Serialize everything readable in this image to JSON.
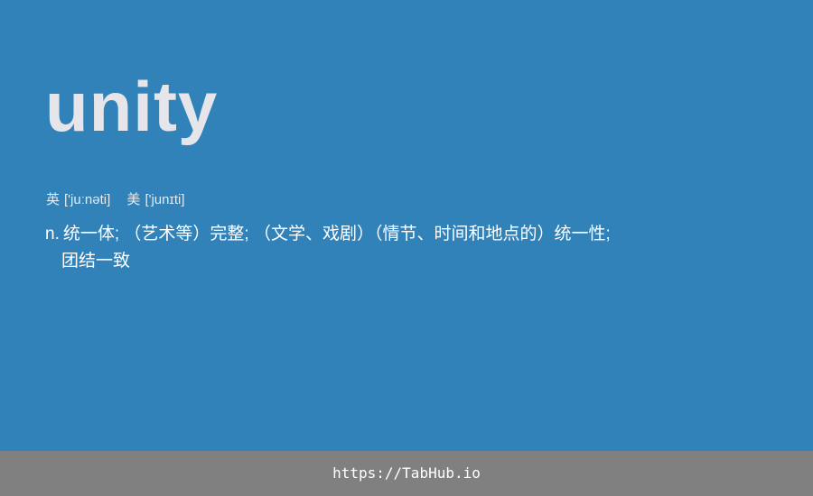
{
  "entry": {
    "word": "unity",
    "phonetics": {
      "uk": {
        "region": "英",
        "ipa": "['juːnəti]"
      },
      "us": {
        "region": "美",
        "ipa": "['junɪti]"
      }
    },
    "definition": {
      "pos": "n.",
      "line1": "统一体; （艺术等）完整; （文学、戏剧）（情节、时间和地点的）统一性;",
      "line2": "团结一致"
    }
  },
  "footer": {
    "url": "https://TabHub.io"
  },
  "colors": {
    "card_background": "#3182b9",
    "word_text": "#e6e6ea",
    "footer_background": "#808080",
    "footer_text": "#ffffff"
  }
}
